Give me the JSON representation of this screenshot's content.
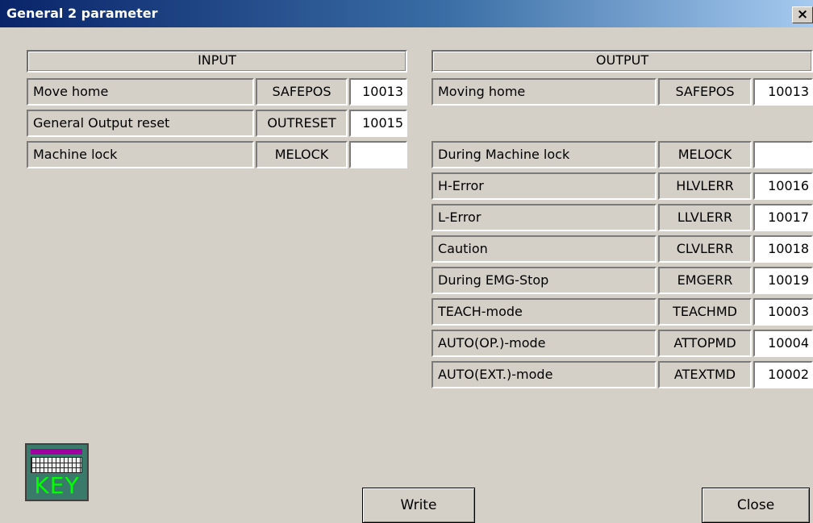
{
  "window": {
    "title": "General 2 parameter",
    "close_glyph": "×"
  },
  "input": {
    "header": "INPUT",
    "rows": [
      {
        "label": "Move home",
        "code": "SAFEPOS",
        "value": "10013"
      },
      {
        "label": "General Output reset",
        "code": "OUTRESET",
        "value": "10015"
      },
      {
        "label": "Machine lock",
        "code": "MELOCK",
        "value": ""
      }
    ]
  },
  "output": {
    "header": "OUTPUT",
    "rows": [
      {
        "label": "Moving home",
        "code": "SAFEPOS",
        "value": "10013"
      },
      {
        "label": "During Machine lock",
        "code": "MELOCK",
        "value": ""
      },
      {
        "label": "H-Error",
        "code": "HLVLERR",
        "value": "10016"
      },
      {
        "label": "L-Error",
        "code": "LLVLERR",
        "value": "10017"
      },
      {
        "label": "Caution",
        "code": "CLVLERR",
        "value": "10018"
      },
      {
        "label": "During EMG-Stop",
        "code": "EMGERR",
        "value": "10019"
      },
      {
        "label": "TEACH-mode",
        "code": "TEACHMD",
        "value": "10003"
      },
      {
        "label": "AUTO(OP.)-mode",
        "code": "ATTOPMD",
        "value": "10004"
      },
      {
        "label": "AUTO(EXT.)-mode",
        "code": "ATEXTMD",
        "value": "10002"
      }
    ]
  },
  "key_icon": {
    "label": "KEY",
    "icon": "keyboard-icon"
  },
  "buttons": {
    "write": "Write",
    "close": "Close"
  }
}
